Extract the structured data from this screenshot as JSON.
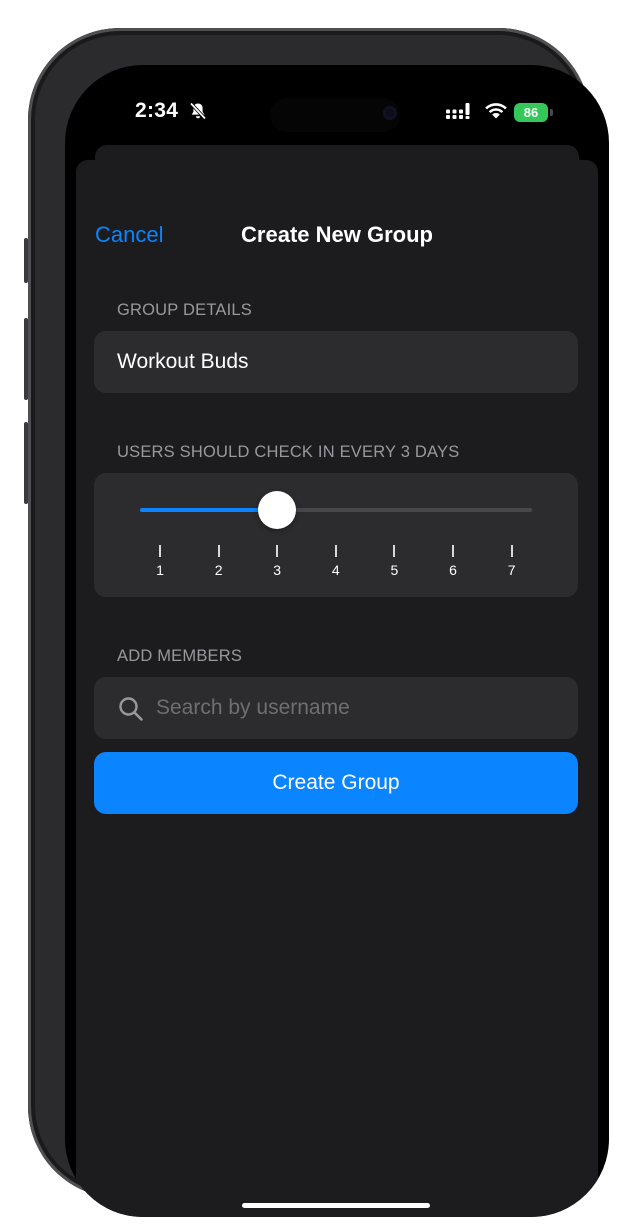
{
  "status_bar": {
    "time": "2:34",
    "battery": "86",
    "icons": [
      "bell-slash-icon",
      "signal-icon",
      "wifi-icon",
      "battery-icon"
    ]
  },
  "nav": {
    "cancel_label": "Cancel",
    "title": "Create New Group"
  },
  "group_details": {
    "header": "GROUP DETAILS",
    "name_value": "Workout Buds"
  },
  "check_in": {
    "header": "USERS SHOULD CHECK IN EVERY 3 DAYS",
    "slider_min": 1,
    "slider_max": 7,
    "slider_value": 3,
    "tick_labels": [
      "1",
      "2",
      "3",
      "4",
      "5",
      "6",
      "7"
    ]
  },
  "members": {
    "header": "ADD MEMBERS",
    "search_placeholder": "Search by username",
    "search_value": ""
  },
  "create_button_label": "Create Group",
  "colors": {
    "accent": "#0a84ff",
    "background": "#1c1c1e",
    "grouped_cell": "#2c2c2e",
    "battery": "#34c759"
  }
}
